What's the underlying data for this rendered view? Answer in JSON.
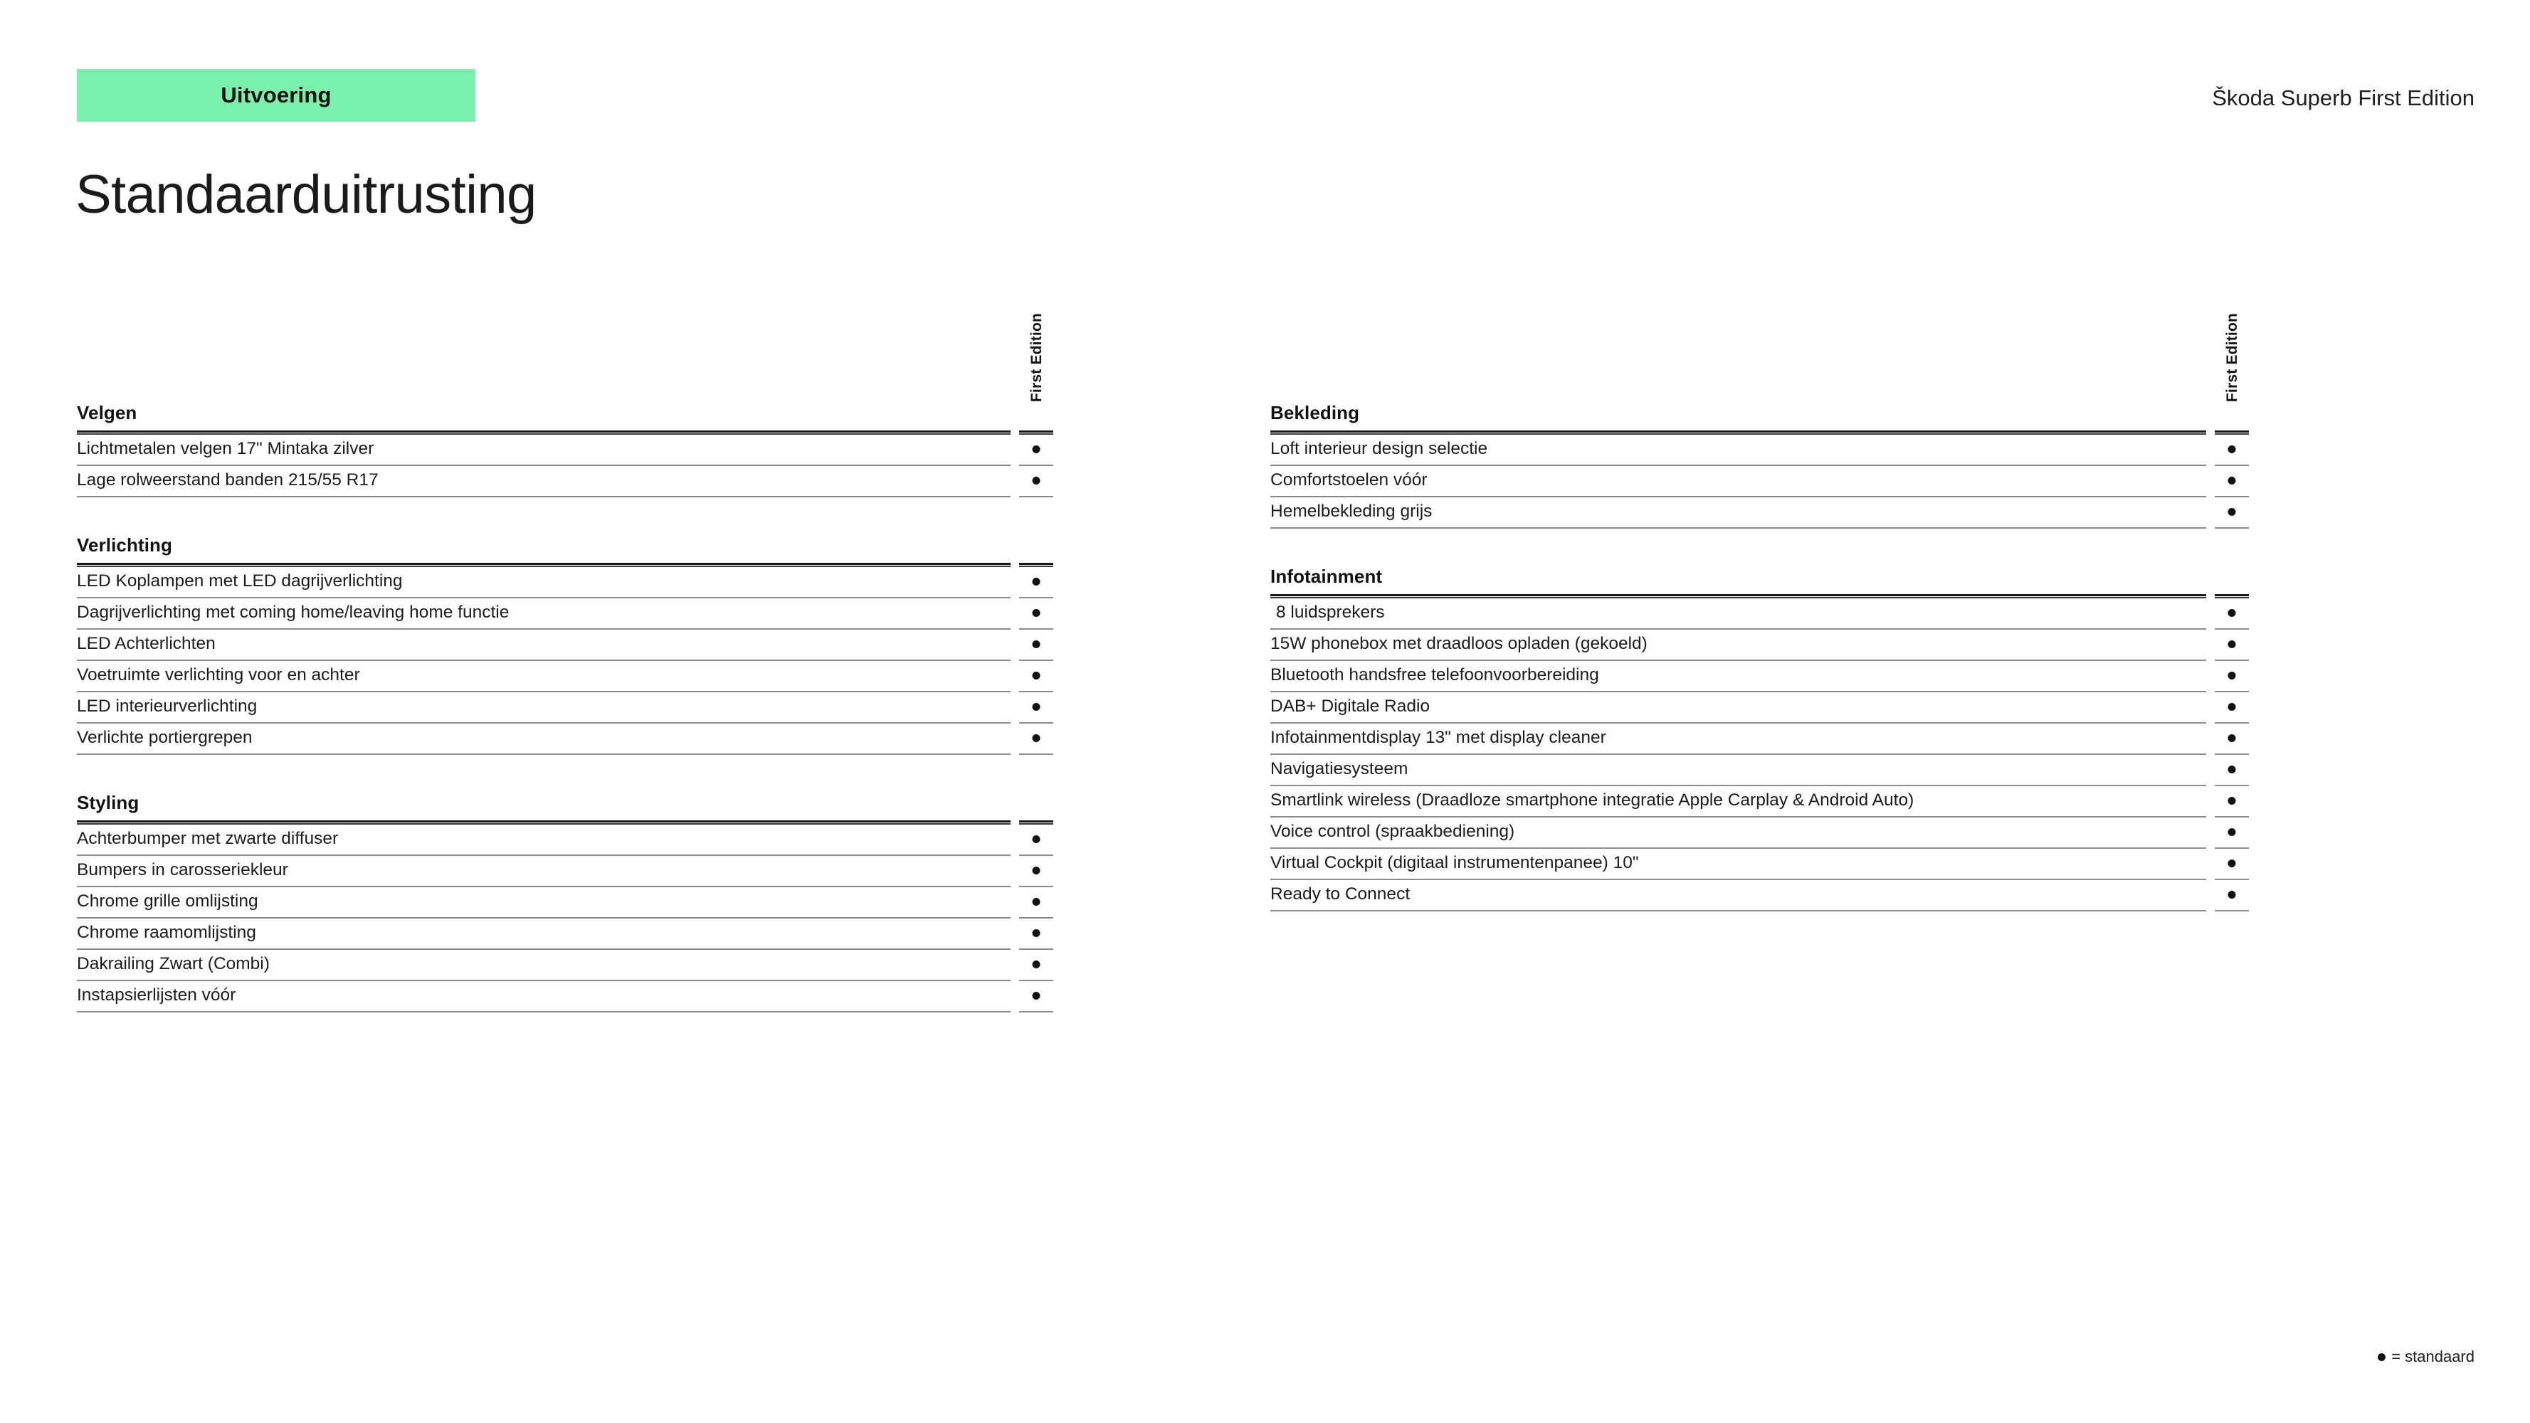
{
  "header": {
    "tag_label": "Uitvoering",
    "page_title": "Standaarduitrusting",
    "model_name": "Škoda Superb First Edition",
    "tag_color": "#79f1ad"
  },
  "column_header": {
    "label": "First Edition"
  },
  "legend": {
    "symbol": "●",
    "text": "= standaard"
  },
  "columns": [
    {
      "name": "left",
      "sections": [
        {
          "title": "Velgen",
          "items": [
            {
              "label": "Lichtmetalen velgen 17\" Mintaka zilver",
              "first_edition": "●"
            },
            {
              "label": "Lage rolweerstand banden 215/55 R17",
              "first_edition": "●"
            }
          ]
        },
        {
          "title": "Verlichting",
          "items": [
            {
              "label": "LED Koplampen met LED dagrijverlichting",
              "first_edition": "●"
            },
            {
              "label": "Dagrijverlichting met coming home/leaving home functie",
              "first_edition": "●"
            },
            {
              "label": "LED Achterlichten",
              "first_edition": "●"
            },
            {
              "label": "Voetruimte verlichting voor en achter",
              "first_edition": "●"
            },
            {
              "label": "LED interieurverlichting",
              "first_edition": "●"
            },
            {
              "label": "Verlichte portiergrepen",
              "first_edition": "●"
            }
          ]
        },
        {
          "title": "Styling",
          "items": [
            {
              "label": "Achterbumper met zwarte diffuser",
              "first_edition": "●"
            },
            {
              "label": "Bumpers in carosseriekleur",
              "first_edition": "●"
            },
            {
              "label": "Chrome grille omlijsting",
              "first_edition": "●"
            },
            {
              "label": "Chrome raamomlijsting",
              "first_edition": "●"
            },
            {
              "label": "Dakrailing Zwart (Combi)",
              "first_edition": "●"
            },
            {
              "label": "Instapsierlijsten vóór",
              "first_edition": "●"
            }
          ]
        }
      ]
    },
    {
      "name": "right",
      "sections": [
        {
          "title": "Bekleding",
          "items": [
            {
              "label": "Loft interieur design selectie",
              "first_edition": "●"
            },
            {
              "label": "Comfortstoelen vóór",
              "first_edition": "●"
            },
            {
              "label": "Hemelbekleding grijs",
              "first_edition": "●"
            }
          ]
        },
        {
          "title": "Infotainment",
          "items": [
            {
              "label": "8 luidsprekers",
              "first_edition": "●",
              "indent": true
            },
            {
              "label": "15W phonebox met draadloos opladen (gekoeld)",
              "first_edition": "●"
            },
            {
              "label": "Bluetooth handsfree telefoonvoorbereiding",
              "first_edition": "●"
            },
            {
              "label": "DAB+ Digitale Radio",
              "first_edition": "●"
            },
            {
              "label": "Infotainmentdisplay 13\" met display cleaner",
              "first_edition": "●"
            },
            {
              "label": "Navigatiesysteem",
              "first_edition": "●"
            },
            {
              "label": "Smartlink wireless (Draadloze smartphone integratie Apple Carplay & Android Auto)",
              "first_edition": "●"
            },
            {
              "label": "Voice control (spraakbediening)",
              "first_edition": "●"
            },
            {
              "label": "Virtual Cockpit  (digitaal instrumentenpanee) 10\"",
              "first_edition": "●"
            },
            {
              "label": "Ready to Connect",
              "first_edition": "●"
            }
          ]
        }
      ]
    }
  ]
}
